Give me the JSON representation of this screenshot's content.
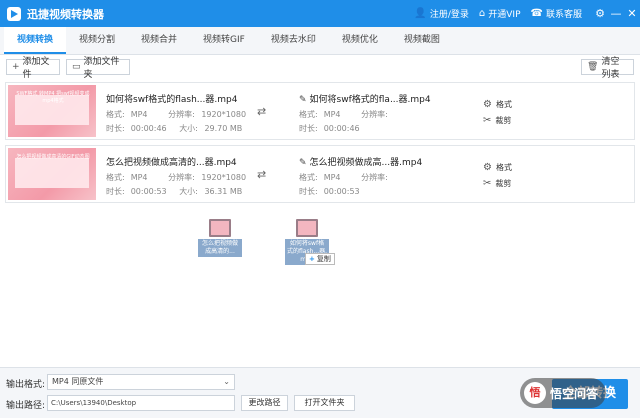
{
  "app": {
    "title": "迅捷视频转换器"
  },
  "titlebar": {
    "login": "注册/登录",
    "vip": "开通VIP",
    "service": "联系客服",
    "controls": [
      "⚙",
      "—",
      "✕"
    ]
  },
  "tabs": [
    "视频转换",
    "视频分割",
    "视频合并",
    "视频转GIF",
    "视频去水印",
    "视频优化",
    "视频截图"
  ],
  "toolbar": {
    "add_file": "添加文件",
    "add_folder": "添加文件夹",
    "clear_list": "清空列表"
  },
  "files": [
    {
      "thumb_text": "SWF格式 转MP4 把swf视频变成mp4格式",
      "name": "如何将swf格式的flash...器.mp4",
      "format_label": "格式:",
      "format": "MP4",
      "res_label": "分辨率:",
      "resolution": "1920*1080",
      "dur_label": "时长:",
      "duration": "00:00:46",
      "size_label": "大小:",
      "size": "29.70 MB",
      "out_name": "如何将swf格式的fla...器.mp4",
      "out_format": "MP4",
      "out_res_label": "分辨率:",
      "out_duration": "00:00:46",
      "action_format": "格式",
      "action_cut": "裁剪"
    },
    {
      "thumb_text": "怎么把视频做成高清的GIF动态图",
      "name": "怎么把视频做成高清的...器.mp4",
      "format_label": "格式:",
      "format": "MP4",
      "res_label": "分辨率:",
      "resolution": "1920*1080",
      "dur_label": "时长:",
      "duration": "00:00:53",
      "size_label": "大小:",
      "size": "36.31 MB",
      "out_name": "怎么把视频做成高...器.mp4",
      "out_format": "MP4",
      "out_res_label": "分辨率:",
      "out_duration": "00:00:53",
      "action_format": "格式",
      "action_cut": "裁剪"
    }
  ],
  "drag": {
    "file1": "怎么把视频做成高清的...",
    "file2": "如何将swf格式的flash...器.mp4",
    "copy_plus": "+",
    "copy": "复制"
  },
  "bottom": {
    "format_label": "输出格式:",
    "format_value": "MP4  同原文件",
    "path_label": "输出路径:",
    "path_value": "C:\\Users\\13940\\Desktop",
    "change_path": "更改路径",
    "open_folder": "打开文件夹",
    "convert_all": "全部转换"
  },
  "watermark": {
    "logo": "悟",
    "text": "悟空问答"
  }
}
